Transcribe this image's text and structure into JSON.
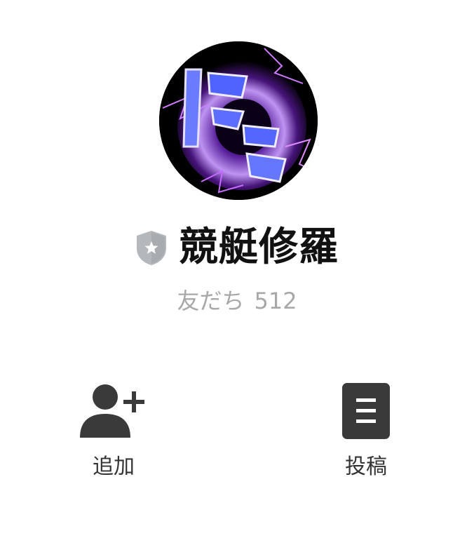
{
  "profile": {
    "name": "競艇修羅",
    "friends_label": "友だち",
    "friends_count": "512",
    "avatar_icon": "avatar-logo-icon",
    "badge_icon": "shield-star-icon"
  },
  "actions": [
    {
      "label": "追加",
      "icon": "add-friend-icon"
    },
    {
      "label": "投稿",
      "icon": "posts-icon"
    }
  ],
  "colors": {
    "name_text": "#111111",
    "secondary_text": "#a8a8a8",
    "icon": "#3a3a3a",
    "badge": "#b5b8bb",
    "avatar_glow": "#9b59ff"
  }
}
